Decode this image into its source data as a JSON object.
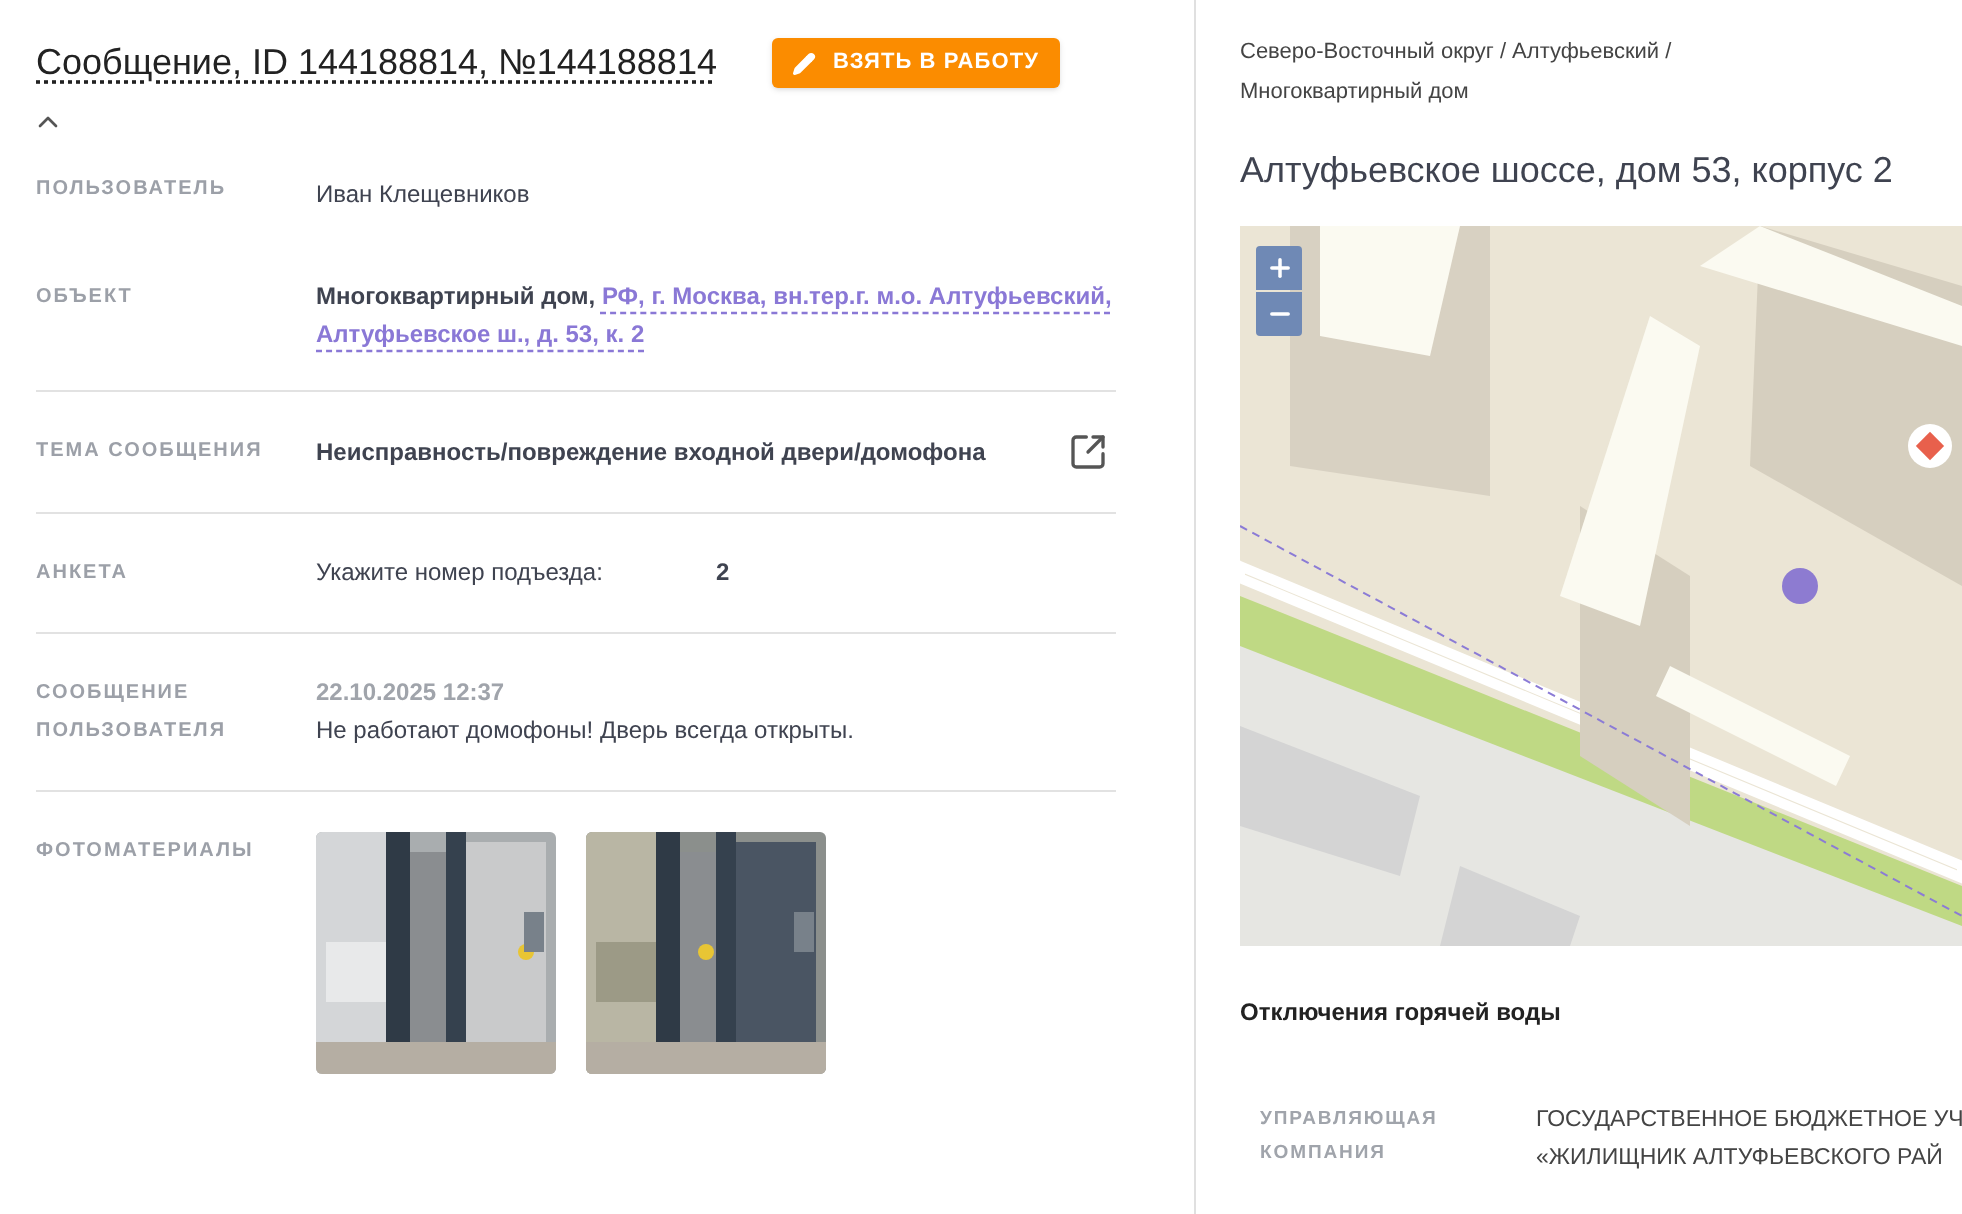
{
  "header": {
    "title": "Сообщение, ID 144188814, №144188814",
    "action_button": "ВЗЯТЬ В РАБОТУ"
  },
  "details": {
    "expanded": true
  },
  "fields": [
    {
      "kind": "text",
      "label": "ПОЛЬЗОВАТЕЛЬ",
      "value": "Иван Клещевников"
    },
    {
      "kind": "object",
      "label": "ОБЪЕКТ",
      "value": "Многоквартирный дом,",
      "link_lines": [
        "РФ, г. Москва, вн.тер.г. м.о. Алтуфьевский,",
        "Алтуфьевское ш., д. 53, к. 2"
      ]
    },
    {
      "kind": "topic",
      "label": "ТЕМА СООБЩЕНИЯ",
      "value": "Неисправность/повреждение входной двери/домофона"
    },
    {
      "kind": "survey",
      "label": "АНКЕТА",
      "question": "Укажите номер подъезда:",
      "answer": "2"
    },
    {
      "kind": "message",
      "label": "СООБЩЕНИЕ ПОЛЬЗОВАТЕЛЯ",
      "time": "22.10.2025 12:37",
      "value": "Не работают домофоны! Дверь всегда открыты."
    },
    {
      "kind": "photos",
      "label": "ФОТОМАТЕРИАЛЫ"
    }
  ],
  "side": {
    "breadcrumb": "Северо-Восточный округ / Алтуфьевский / Многоквартирный дом",
    "address": "Алтуфьевское шоссе, дом 53, корпус 2",
    "section_title": "Отключения горячей воды",
    "info": [
      {
        "label": "УПРАВЛЯЮЩАЯ КОМПАНИЯ",
        "lines": [
          "ГОСУДАРСТВЕННОЕ БЮДЖЕТНОЕ УЧ",
          "«ЖИЛИЩНИК АЛТУФЬЕВСКОГО РАЙ"
        ]
      }
    ]
  }
}
